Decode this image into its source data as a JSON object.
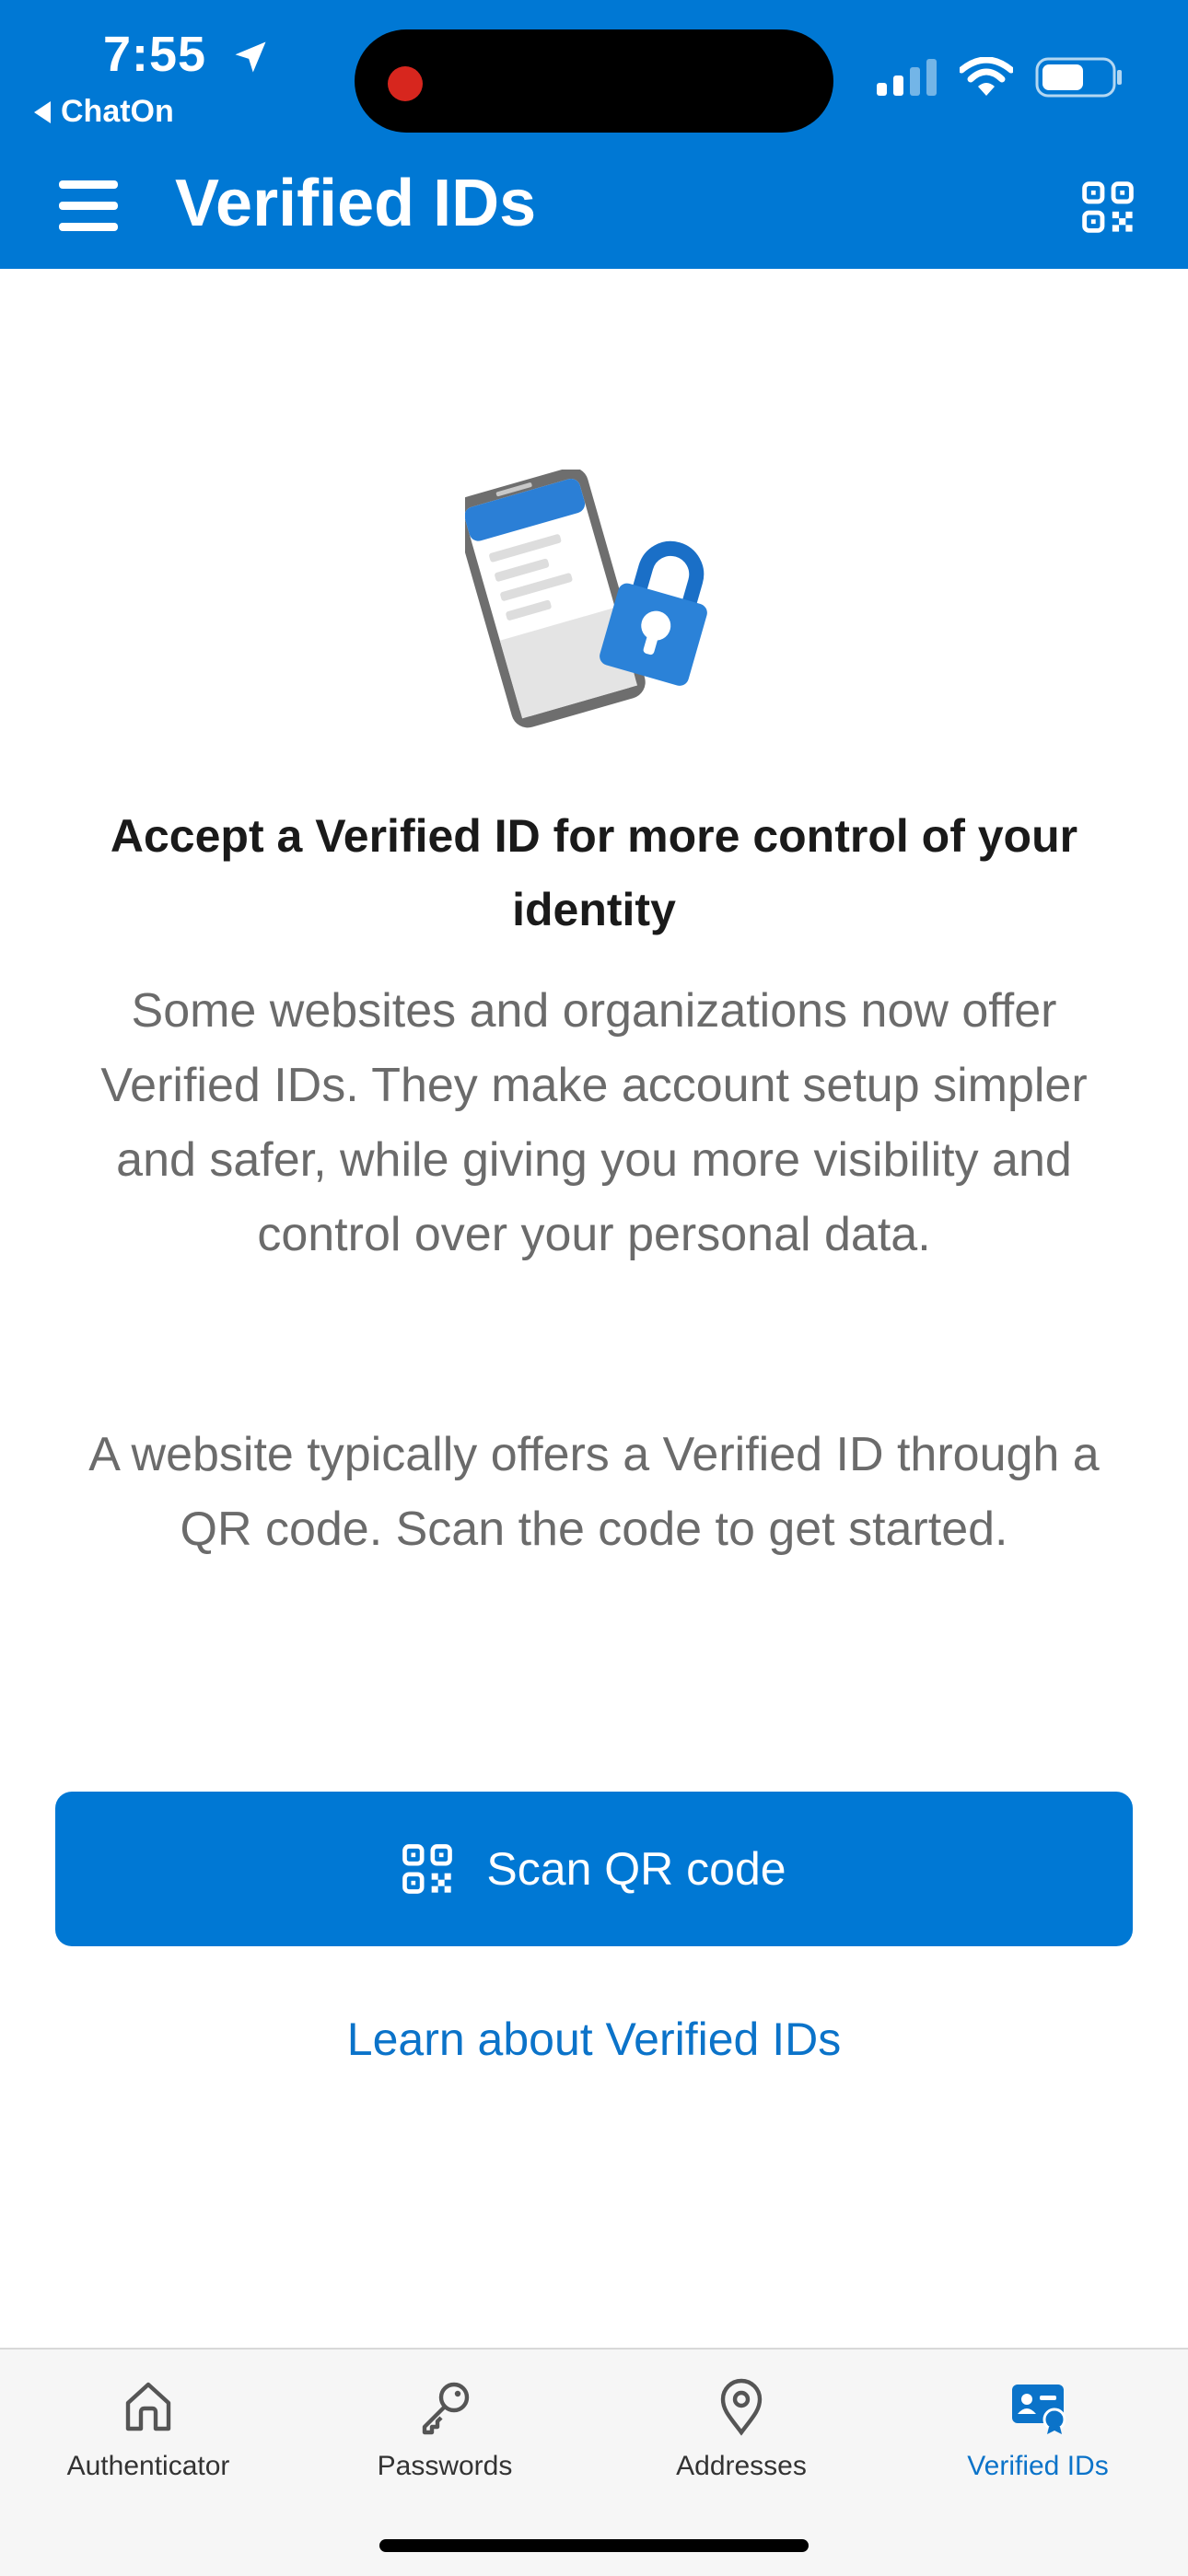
{
  "status_bar": {
    "time": "7:55",
    "back_app": "ChatOn"
  },
  "header": {
    "title": "Verified IDs"
  },
  "content": {
    "headline": "Accept a Verified ID for more control of your identity",
    "paragraph1": "Some websites and organizations now offer Verified IDs. They make account setup simpler and safer, while giving you more visibility and control over your personal data.",
    "paragraph2": "A website typically offers a Verified ID through a QR code. Scan the code to get started.",
    "scan_button": "Scan QR code",
    "learn_link": "Learn about Verified IDs"
  },
  "tabs": [
    {
      "label": "Authenticator",
      "icon": "home-icon",
      "active": false
    },
    {
      "label": "Passwords",
      "icon": "key-icon",
      "active": false
    },
    {
      "label": "Addresses",
      "icon": "location-pin-icon",
      "active": false
    },
    {
      "label": "Verified IDs",
      "icon": "id-card-icon",
      "active": true
    }
  ],
  "colors": {
    "brand": "#0078d4",
    "link": "#0b73c9",
    "text_muted": "#6b6b6b"
  }
}
